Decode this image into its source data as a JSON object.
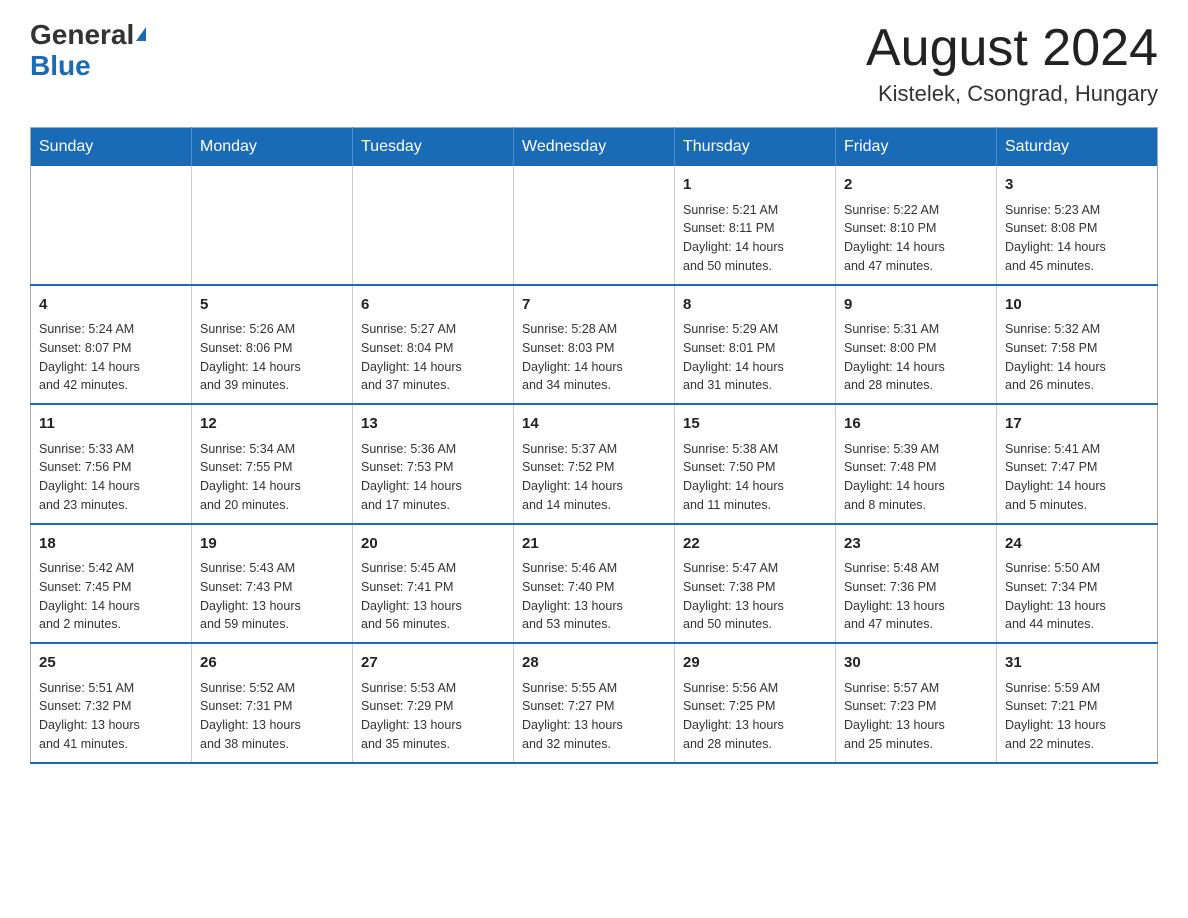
{
  "header": {
    "logo_general": "General",
    "logo_blue": "Blue",
    "month_title": "August 2024",
    "location": "Kistelek, Csongrad, Hungary"
  },
  "weekdays": [
    "Sunday",
    "Monday",
    "Tuesday",
    "Wednesday",
    "Thursday",
    "Friday",
    "Saturday"
  ],
  "weeks": [
    [
      {
        "day": "",
        "info": ""
      },
      {
        "day": "",
        "info": ""
      },
      {
        "day": "",
        "info": ""
      },
      {
        "day": "",
        "info": ""
      },
      {
        "day": "1",
        "info": "Sunrise: 5:21 AM\nSunset: 8:11 PM\nDaylight: 14 hours\nand 50 minutes."
      },
      {
        "day": "2",
        "info": "Sunrise: 5:22 AM\nSunset: 8:10 PM\nDaylight: 14 hours\nand 47 minutes."
      },
      {
        "day": "3",
        "info": "Sunrise: 5:23 AM\nSunset: 8:08 PM\nDaylight: 14 hours\nand 45 minutes."
      }
    ],
    [
      {
        "day": "4",
        "info": "Sunrise: 5:24 AM\nSunset: 8:07 PM\nDaylight: 14 hours\nand 42 minutes."
      },
      {
        "day": "5",
        "info": "Sunrise: 5:26 AM\nSunset: 8:06 PM\nDaylight: 14 hours\nand 39 minutes."
      },
      {
        "day": "6",
        "info": "Sunrise: 5:27 AM\nSunset: 8:04 PM\nDaylight: 14 hours\nand 37 minutes."
      },
      {
        "day": "7",
        "info": "Sunrise: 5:28 AM\nSunset: 8:03 PM\nDaylight: 14 hours\nand 34 minutes."
      },
      {
        "day": "8",
        "info": "Sunrise: 5:29 AM\nSunset: 8:01 PM\nDaylight: 14 hours\nand 31 minutes."
      },
      {
        "day": "9",
        "info": "Sunrise: 5:31 AM\nSunset: 8:00 PM\nDaylight: 14 hours\nand 28 minutes."
      },
      {
        "day": "10",
        "info": "Sunrise: 5:32 AM\nSunset: 7:58 PM\nDaylight: 14 hours\nand 26 minutes."
      }
    ],
    [
      {
        "day": "11",
        "info": "Sunrise: 5:33 AM\nSunset: 7:56 PM\nDaylight: 14 hours\nand 23 minutes."
      },
      {
        "day": "12",
        "info": "Sunrise: 5:34 AM\nSunset: 7:55 PM\nDaylight: 14 hours\nand 20 minutes."
      },
      {
        "day": "13",
        "info": "Sunrise: 5:36 AM\nSunset: 7:53 PM\nDaylight: 14 hours\nand 17 minutes."
      },
      {
        "day": "14",
        "info": "Sunrise: 5:37 AM\nSunset: 7:52 PM\nDaylight: 14 hours\nand 14 minutes."
      },
      {
        "day": "15",
        "info": "Sunrise: 5:38 AM\nSunset: 7:50 PM\nDaylight: 14 hours\nand 11 minutes."
      },
      {
        "day": "16",
        "info": "Sunrise: 5:39 AM\nSunset: 7:48 PM\nDaylight: 14 hours\nand 8 minutes."
      },
      {
        "day": "17",
        "info": "Sunrise: 5:41 AM\nSunset: 7:47 PM\nDaylight: 14 hours\nand 5 minutes."
      }
    ],
    [
      {
        "day": "18",
        "info": "Sunrise: 5:42 AM\nSunset: 7:45 PM\nDaylight: 14 hours\nand 2 minutes."
      },
      {
        "day": "19",
        "info": "Sunrise: 5:43 AM\nSunset: 7:43 PM\nDaylight: 13 hours\nand 59 minutes."
      },
      {
        "day": "20",
        "info": "Sunrise: 5:45 AM\nSunset: 7:41 PM\nDaylight: 13 hours\nand 56 minutes."
      },
      {
        "day": "21",
        "info": "Sunrise: 5:46 AM\nSunset: 7:40 PM\nDaylight: 13 hours\nand 53 minutes."
      },
      {
        "day": "22",
        "info": "Sunrise: 5:47 AM\nSunset: 7:38 PM\nDaylight: 13 hours\nand 50 minutes."
      },
      {
        "day": "23",
        "info": "Sunrise: 5:48 AM\nSunset: 7:36 PM\nDaylight: 13 hours\nand 47 minutes."
      },
      {
        "day": "24",
        "info": "Sunrise: 5:50 AM\nSunset: 7:34 PM\nDaylight: 13 hours\nand 44 minutes."
      }
    ],
    [
      {
        "day": "25",
        "info": "Sunrise: 5:51 AM\nSunset: 7:32 PM\nDaylight: 13 hours\nand 41 minutes."
      },
      {
        "day": "26",
        "info": "Sunrise: 5:52 AM\nSunset: 7:31 PM\nDaylight: 13 hours\nand 38 minutes."
      },
      {
        "day": "27",
        "info": "Sunrise: 5:53 AM\nSunset: 7:29 PM\nDaylight: 13 hours\nand 35 minutes."
      },
      {
        "day": "28",
        "info": "Sunrise: 5:55 AM\nSunset: 7:27 PM\nDaylight: 13 hours\nand 32 minutes."
      },
      {
        "day": "29",
        "info": "Sunrise: 5:56 AM\nSunset: 7:25 PM\nDaylight: 13 hours\nand 28 minutes."
      },
      {
        "day": "30",
        "info": "Sunrise: 5:57 AM\nSunset: 7:23 PM\nDaylight: 13 hours\nand 25 minutes."
      },
      {
        "day": "31",
        "info": "Sunrise: 5:59 AM\nSunset: 7:21 PM\nDaylight: 13 hours\nand 22 minutes."
      }
    ]
  ]
}
